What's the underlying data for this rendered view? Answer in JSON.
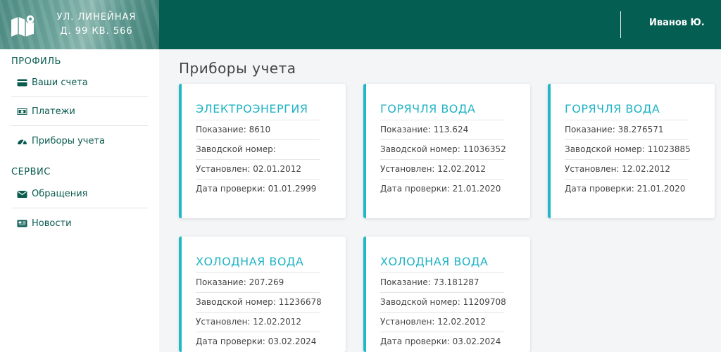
{
  "header": {
    "address_line1": "УЛ. ЛИНЕЙНАЯ",
    "address_line2": "Д. 99 КВ. 566",
    "user_name": "Иванов Ю."
  },
  "sidebar": {
    "sections": [
      {
        "title": "ПРОФИЛЬ",
        "items": [
          {
            "label": "Ваши счета",
            "icon": "credit-card-icon"
          },
          {
            "label": "Платежи",
            "icon": "money-icon"
          },
          {
            "label": "Приборы учета",
            "icon": "gauge-icon"
          }
        ]
      },
      {
        "title": "СЕРВИС",
        "items": [
          {
            "label": "Обращения",
            "icon": "envelope-icon"
          },
          {
            "label": "Новости",
            "icon": "newspaper-icon"
          }
        ]
      }
    ]
  },
  "main": {
    "title": "Приборы учета",
    "meters": [
      {
        "title": "ЭЛЕКТРОЭНЕРГИЯ",
        "reading": "Показание: 8610",
        "serial": "Заводской номер:",
        "installed": "Установлен: 02.01.2012",
        "checked": "Дата проверки: 01.01.2999"
      },
      {
        "title": "ГОРЯЧЛЯ ВОДА",
        "reading": "Показание: 113.624",
        "serial": "Заводской номер: 11036352",
        "installed": "Установлен: 12.02.2012",
        "checked": "Дата проверки: 21.01.2020"
      },
      {
        "title": "ГОРЯЧЛЯ ВОДА",
        "reading": "Показание: 38.276571",
        "serial": "Заводской номер: 11023885",
        "installed": "Установлен: 12.02.2012",
        "checked": "Дата проверки: 21.01.2020"
      },
      {
        "title": "ХОЛОДНАЯ ВОДА",
        "reading": "Показание: 207.269",
        "serial": "Заводской номер: 11236678",
        "installed": "Установлен: 12.02.2012",
        "checked": "Дата проверки: 03.02.2024"
      },
      {
        "title": "ХОЛОДНАЯ ВОДА",
        "reading": "Показание: 73.181287",
        "serial": "Заводской номер: 11209708",
        "installed": "Установлен: 12.02.2012",
        "checked": "Дата проверки: 03.02.2024"
      }
    ]
  },
  "colors": {
    "header": "#055e52",
    "accent": "#20b8c6",
    "nav_text": "#0a5b50"
  }
}
